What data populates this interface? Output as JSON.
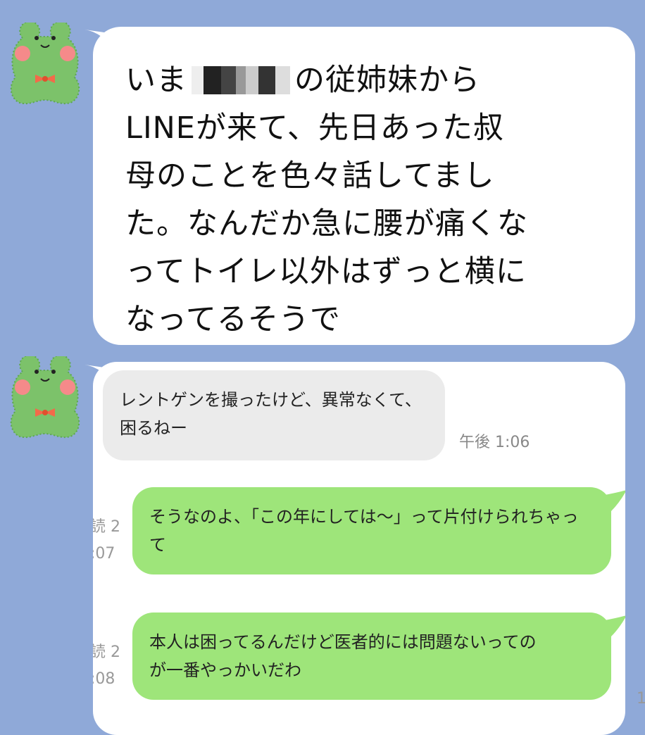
{
  "big_message": {
    "prefix": "いま",
    "suffix": "の従姉妹から",
    "body": "LINEが来て、先日あった叔\n母のことを色々話してまし\nた。なんだか急に腰が痛くな\nってトイレ以外はずっと横に\nなってるそうで"
  },
  "screenshot": {
    "incoming": {
      "text": "レントゲンを撮ったけど、異常なくて、\n困るねー",
      "time": "午後 1:06"
    },
    "outgoing": [
      {
        "text": "そうなのよ、「この年にしては〜」って片付けられちゃっ\nて",
        "meta": "読 2\n:07"
      },
      {
        "text": "本人は困ってるんだけど医者的には問題ないっての\nが一番やっかいだわ",
        "meta": "読 2\n:08"
      }
    ],
    "edge_digit": "1"
  },
  "colors": {
    "background": "#8fa9d8",
    "outgoing_bubble": "#9ee57a",
    "incoming_bubble": "#ebebeb"
  },
  "icons": [
    "frog-avatar-icon"
  ]
}
